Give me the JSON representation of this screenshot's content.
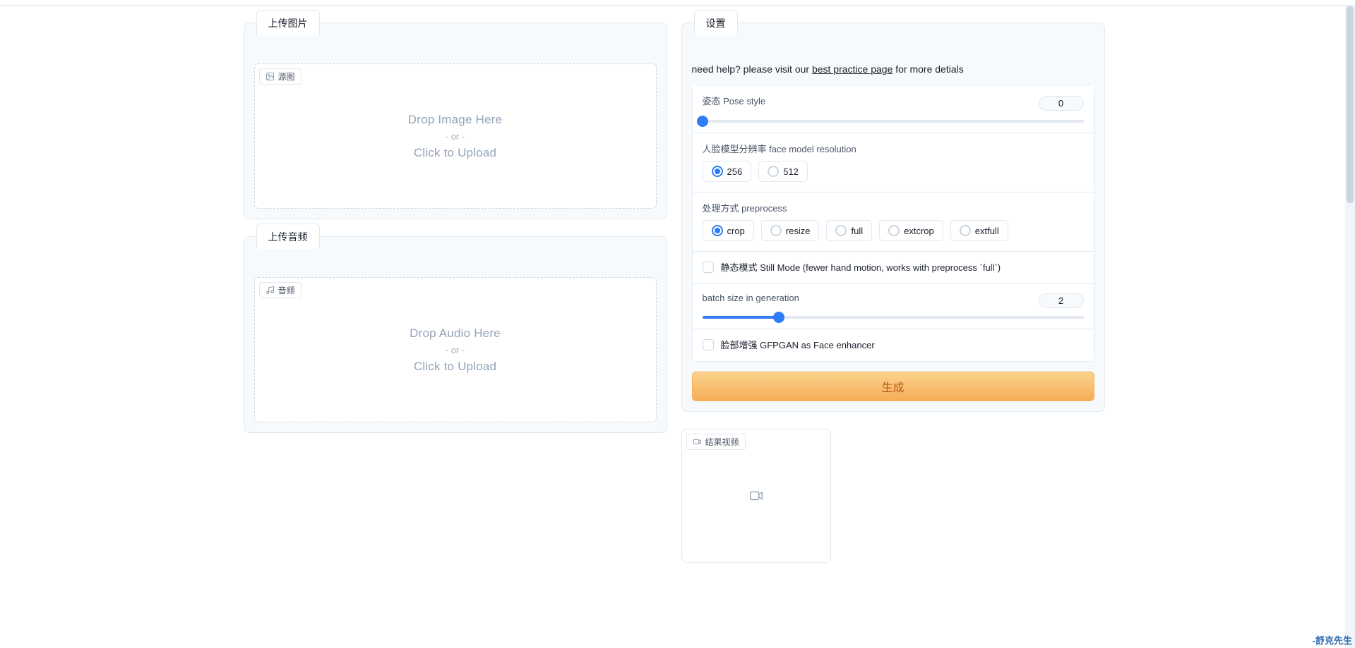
{
  "tabs": {
    "upload_image": "上传图片",
    "upload_audio": "上传音频",
    "settings": "设置"
  },
  "image_drop": {
    "chip": "源图",
    "title": "Drop Image Here",
    "or": "- or -",
    "click": "Click to Upload"
  },
  "audio_drop": {
    "chip": "音频",
    "title": "Drop Audio Here",
    "or": "- or -",
    "click": "Click to Upload"
  },
  "help": {
    "prefix": "need help? please visit our ",
    "link": "best practice page",
    "suffix": " for more detials"
  },
  "settings": {
    "pose_style": {
      "label": "姿态 Pose style",
      "value": "0",
      "min": 0,
      "max": 45,
      "percent": 0
    },
    "face_res": {
      "label": "人脸模型分辨率 face model resolution",
      "options": [
        "256",
        "512"
      ],
      "selected": "256"
    },
    "preprocess": {
      "label": "处理方式 preprocess",
      "options": [
        "crop",
        "resize",
        "full",
        "extcrop",
        "extfull"
      ],
      "selected": "crop"
    },
    "still_mode": {
      "label": "静态模式 Still Mode (fewer hand motion, works with preprocess `full`)",
      "checked": false
    },
    "batch": {
      "label": "batch size in generation",
      "value": "2",
      "min": 1,
      "max": 10,
      "percent": 20
    },
    "enhancer": {
      "label": "脸部增强 GFPGAN as Face enhancer",
      "checked": false
    },
    "generate_label": "生成"
  },
  "result": {
    "chip": "结果视频"
  },
  "watermark": "-舒克先生"
}
